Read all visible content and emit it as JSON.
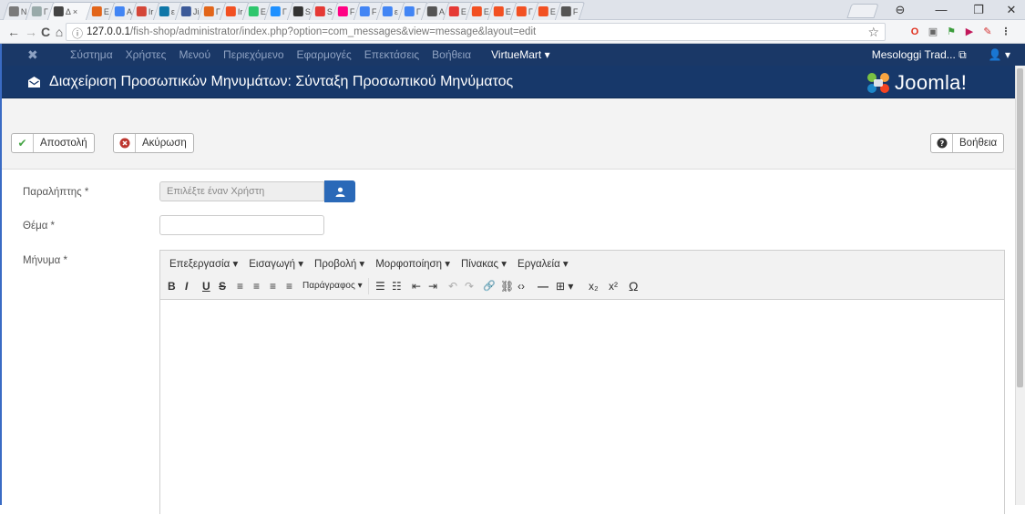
{
  "browser": {
    "tabs": [
      {
        "label": "N",
        "icon": "news",
        "color": "#7a7a7a"
      },
      {
        "label": "Γ",
        "icon": "globe",
        "color": "#9aa"
      },
      {
        "label": "Δ ×",
        "icon": "active-tab",
        "color": "#444",
        "active": true
      },
      {
        "label": "E",
        "icon": "joomla",
        "color": "#e2651a"
      },
      {
        "label": "A",
        "icon": "google",
        "color": "#4285f4"
      },
      {
        "label": "Ir",
        "icon": "gmail",
        "color": "#d44638"
      },
      {
        "label": "ε",
        "icon": "linkedin",
        "color": "#0e76a8"
      },
      {
        "label": "Ji",
        "icon": "image",
        "color": "#3c5a99"
      },
      {
        "label": "Γ",
        "icon": "joomla",
        "color": "#e2651a"
      },
      {
        "label": "Ir",
        "icon": "windows",
        "color": "#f25022"
      },
      {
        "label": "E",
        "icon": "pixabay",
        "color": "#2ec66d"
      },
      {
        "label": "Γ",
        "icon": "drop",
        "color": "#1e90ff"
      },
      {
        "label": "S",
        "icon": "bold-b",
        "color": "#333"
      },
      {
        "label": "S",
        "icon": "red-square",
        "color": "#e53935"
      },
      {
        "label": "F",
        "icon": "flickr",
        "color": "#ff0084"
      },
      {
        "label": "F",
        "icon": "google",
        "color": "#4285f4"
      },
      {
        "label": "ε",
        "icon": "google",
        "color": "#4285f4"
      },
      {
        "label": "Γ",
        "icon": "google",
        "color": "#4285f4"
      },
      {
        "label": "A",
        "icon": "person",
        "color": "#555"
      },
      {
        "label": "E",
        "icon": "pause",
        "color": "#e53935"
      },
      {
        "label": "E",
        "icon": "windows",
        "color": "#f25022"
      },
      {
        "label": "E",
        "icon": "windows",
        "color": "#f25022"
      },
      {
        "label": "Γ",
        "icon": "windows",
        "color": "#f25022"
      },
      {
        "label": "E",
        "icon": "windows",
        "color": "#f25022"
      },
      {
        "label": "F",
        "icon": "camera",
        "color": "#555"
      }
    ],
    "window_controls": {
      "profile": "⊖",
      "minimize": "—",
      "restore": "❐",
      "close": "✕"
    },
    "url_host": "127.0.0.1",
    "url_path": "/fish-shop/administrator/index.php?option=com_messages&view=message&layout=edit",
    "nav": {
      "back": "←",
      "forward": "→",
      "reload": "C",
      "home": "⌂"
    },
    "extensions": [
      {
        "glyph": "O",
        "color": "#e0301e",
        "bg": "transparent"
      },
      {
        "glyph": "▣",
        "color": "#666",
        "bg": "transparent"
      },
      {
        "glyph": "⚑",
        "color": "#3c9c3c",
        "bg": "transparent"
      },
      {
        "glyph": "▶",
        "color": "#c2185b",
        "bg": "transparent"
      },
      {
        "glyph": "✎",
        "color": "#d32f2f",
        "bg": "transparent"
      },
      {
        "glyph": "⋮",
        "color": "#555",
        "bg": "transparent"
      }
    ]
  },
  "admin_menu": {
    "items": [
      "Σύστημα",
      "Χρήστες",
      "Μενού",
      "Περιεχόμενο",
      "Εφαρμογές",
      "Επεκτάσεις",
      "Βοήθεια"
    ],
    "virtuemart": "VirtueMart ▾",
    "site_link": "Mesologgi Trad... ⧉",
    "user": "👤 ▾"
  },
  "header": {
    "title": "Διαχείριση Προσωπικών Μηνυμάτων: Σύνταξη Προσωπικού Μηνύματος",
    "logo_text": "Joomla!"
  },
  "toolbar": {
    "send": "Αποστολή",
    "cancel": "Ακύρωση",
    "help": "Βοήθεια"
  },
  "form": {
    "recipient_label": "Παραλήπτης *",
    "recipient_placeholder": "Επιλέξτε έναν Χρήστη",
    "subject_label": "Θέμα *",
    "message_label": "Μήνυμα *"
  },
  "editor": {
    "menus": [
      "Επεξεργασία ▾",
      "Εισαγωγή ▾",
      "Προβολή ▾",
      "Μορφοποίηση ▾",
      "Πίνακας ▾",
      "Εργαλεία ▾"
    ],
    "format_select": "Παράγραφος ▾",
    "buttons": {
      "bold": "B",
      "italic": "I",
      "underline": "U",
      "strike": "S",
      "align_left": "≡",
      "align_center": "≡",
      "align_right": "≡",
      "justify": "≡",
      "bullet_list": "☰",
      "num_list": "☷",
      "outdent": "⇤",
      "indent": "⇥",
      "undo": "↶",
      "redo": "↷",
      "link": "🔗",
      "unlink": "⛓",
      "code": "‹›",
      "hr": "—",
      "table": "⊞ ▾",
      "subscript": "x₂",
      "superscript": "x²",
      "omega": "Ω"
    }
  }
}
